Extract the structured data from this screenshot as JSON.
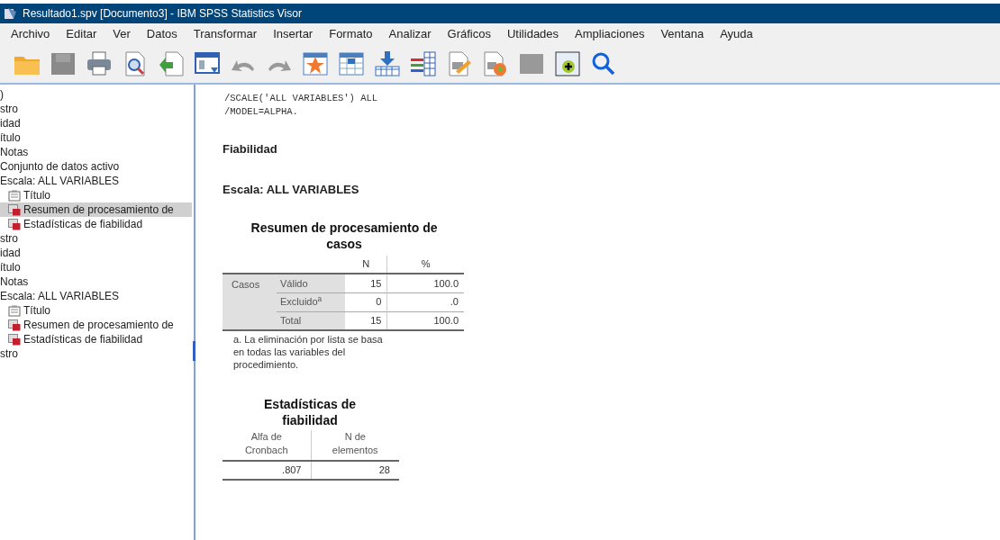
{
  "window": {
    "title": "Resultado1.spv [Documento3] - IBM SPSS Statistics Visor"
  },
  "menu": [
    {
      "label": "Archivo"
    },
    {
      "label": "Editar"
    },
    {
      "label": "Ver"
    },
    {
      "label": "Datos"
    },
    {
      "label": "Transformar"
    },
    {
      "label": "Insertar"
    },
    {
      "label": "Formato"
    },
    {
      "label": "Analizar"
    },
    {
      "label": "Gráficos"
    },
    {
      "label": "Utilidades"
    },
    {
      "label": "Ampliaciones"
    },
    {
      "label": "Ventana"
    },
    {
      "label": "Ayuda"
    }
  ],
  "toolbar": [
    {
      "kind": "folder",
      "disabled": false
    },
    {
      "kind": "save",
      "disabled": true
    },
    {
      "kind": "print",
      "disabled": false
    },
    {
      "kind": "preview",
      "disabled": false
    },
    {
      "kind": "export",
      "disabled": false
    },
    {
      "kind": "window",
      "disabled": false
    },
    {
      "kind": "undo",
      "disabled": true
    },
    {
      "kind": "redo",
      "disabled": true
    },
    {
      "kind": "star",
      "disabled": false
    },
    {
      "kind": "grid",
      "disabled": false
    },
    {
      "kind": "insert",
      "disabled": false
    },
    {
      "kind": "bars",
      "disabled": false
    },
    {
      "kind": "edit",
      "disabled": false
    },
    {
      "kind": "run",
      "disabled": false
    },
    {
      "kind": "blank",
      "disabled": true
    },
    {
      "kind": "add",
      "disabled": false
    },
    {
      "kind": "search",
      "disabled": false
    }
  ],
  "outline": [
    {
      "label": ")",
      "kind": "text",
      "selected": false
    },
    {
      "label": "stro",
      "kind": "text",
      "selected": false
    },
    {
      "label": "idad",
      "kind": "text",
      "selected": false
    },
    {
      "label": "ítulo",
      "kind": "text",
      "selected": false
    },
    {
      "label": "Notas",
      "kind": "text",
      "selected": false
    },
    {
      "label": "Conjunto de datos activo",
      "kind": "text",
      "selected": false
    },
    {
      "label": "Escala: ALL VARIABLES",
      "kind": "text",
      "selected": false
    },
    {
      "label": "Título",
      "kind": "title",
      "selected": false
    },
    {
      "label": "Resumen de procesamiento de",
      "kind": "table",
      "selected": true
    },
    {
      "label": "Estadísticas de fiabilidad",
      "kind": "table",
      "selected": false
    },
    {
      "label": "stro",
      "kind": "text",
      "selected": false
    },
    {
      "label": "idad",
      "kind": "text",
      "selected": false
    },
    {
      "label": "ítulo",
      "kind": "text",
      "selected": false
    },
    {
      "label": "Notas",
      "kind": "text",
      "selected": false
    },
    {
      "label": "Escala: ALL VARIABLES",
      "kind": "text",
      "selected": false
    },
    {
      "label": "Título",
      "kind": "title",
      "selected": false
    },
    {
      "label": "Resumen de procesamiento de",
      "kind": "table",
      "selected": false
    },
    {
      "label": "Estadísticas de fiabilidad",
      "kind": "table",
      "selected": false
    },
    {
      "label": "stro",
      "kind": "text",
      "selected": false
    }
  ],
  "output": {
    "syntax": [
      "/SCALE('ALL VARIABLES') ALL",
      "/MODEL=ALPHA."
    ],
    "heading": "Fiabilidad",
    "subheading": "Escala: ALL VARIABLES",
    "case_table": {
      "title": "Resumen de procesamiento de casos",
      "columns": [
        "N",
        "%"
      ],
      "group": "Casos",
      "rows": [
        {
          "label": "Válido",
          "n": "15",
          "pct": "100.0"
        },
        {
          "label": "Excluido$^{a}$",
          "n": "0",
          "pct": ".0"
        },
        {
          "label": "Total",
          "n": "15",
          "pct": "100.0"
        }
      ],
      "footnote": "a. La eliminación por lista se basa en todas las variables del procedimiento."
    },
    "reliability_table": {
      "title": "Estadísticas de fiabilidad",
      "columns": [
        "Alfa de Cronbach",
        "N de elementos"
      ],
      "values": [
        ".807",
        "28"
      ]
    }
  }
}
